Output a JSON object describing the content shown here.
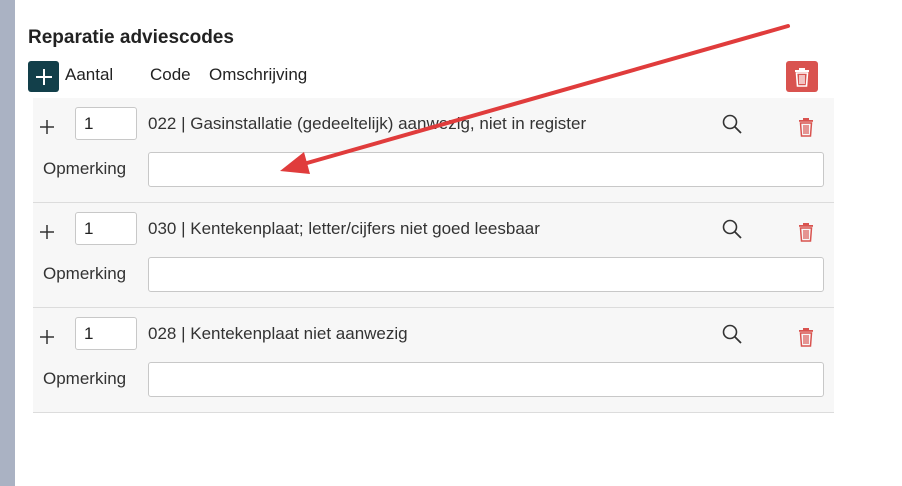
{
  "section": {
    "title": "Reparatie adviescodes",
    "columns": {
      "aantal": "Aantal",
      "code": "Code",
      "omschrijving": "Omschrijving"
    }
  },
  "rows": [
    {
      "quantity": "1",
      "description": "022 | Gasinstallatie (gedeeltelijk) aanwezig, niet in register",
      "remark_label": "Opmerking",
      "remark_value": ""
    },
    {
      "quantity": "1",
      "description": "030 | Kentekenplaat; letter/cijfers niet goed leesbaar",
      "remark_label": "Opmerking",
      "remark_value": ""
    },
    {
      "quantity": "1",
      "description": "028 | Kentekenplaat niet aanwezig",
      "remark_label": "Opmerking",
      "remark_value": ""
    }
  ],
  "colors": {
    "accent": "#123f4a",
    "danger": "#d9534f",
    "annotation_arrow": "#e03c3c"
  },
  "icons": {
    "add": "plus-icon",
    "delete": "trash-icon",
    "search": "search-icon"
  }
}
